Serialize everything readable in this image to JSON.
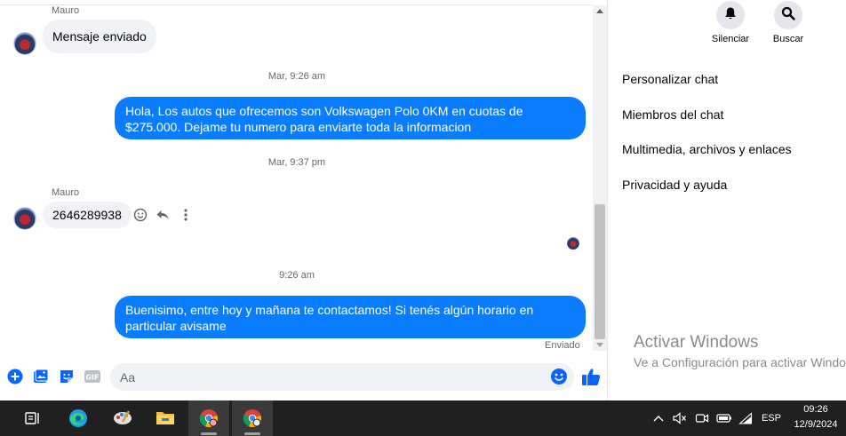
{
  "chat": {
    "messages": [
      {
        "sender": "Mauro",
        "text": "Mensaje enviado"
      },
      {
        "timestamp": "Mar, 9:26 am"
      },
      {
        "text": "Hola, Los autos que ofrecemos son Volkswagen Polo 0KM en cuotas de $275.000. Dejame tu numero para enviarte toda la informacion"
      },
      {
        "timestamp": "Mar, 9:37 pm"
      },
      {
        "sender": "Mauro",
        "text": "2646289938"
      },
      {
        "timestamp": "9:26 am"
      },
      {
        "text": "Buenisimo, entre hoy y mañana te contactamos! Si tenés algún horario en particular avisame"
      }
    ],
    "sent_status": "Enviado"
  },
  "composer": {
    "placeholder": "Aa",
    "gif_label": "GIF"
  },
  "right_panel": {
    "actions": [
      {
        "label": "Silenciar",
        "icon": "bell-icon"
      },
      {
        "label": "Buscar",
        "icon": "search-icon"
      }
    ],
    "menu": [
      "Personalizar chat",
      "Miembros del chat",
      "Multimedia, archivos y enlaces",
      "Privacidad y ayuda"
    ]
  },
  "watermark": {
    "title": "Activar Windows",
    "subtitle": "Ve a Configuración para activar Windows."
  },
  "taskbar": {
    "language": "ESP",
    "time": "09:26",
    "date": "12/9/2024"
  },
  "colors": {
    "outgoing_bubble": "#0a7cff",
    "incoming_bubble": "#f0f2f5",
    "accent": "#0866ff",
    "taskbar": "#202020"
  }
}
